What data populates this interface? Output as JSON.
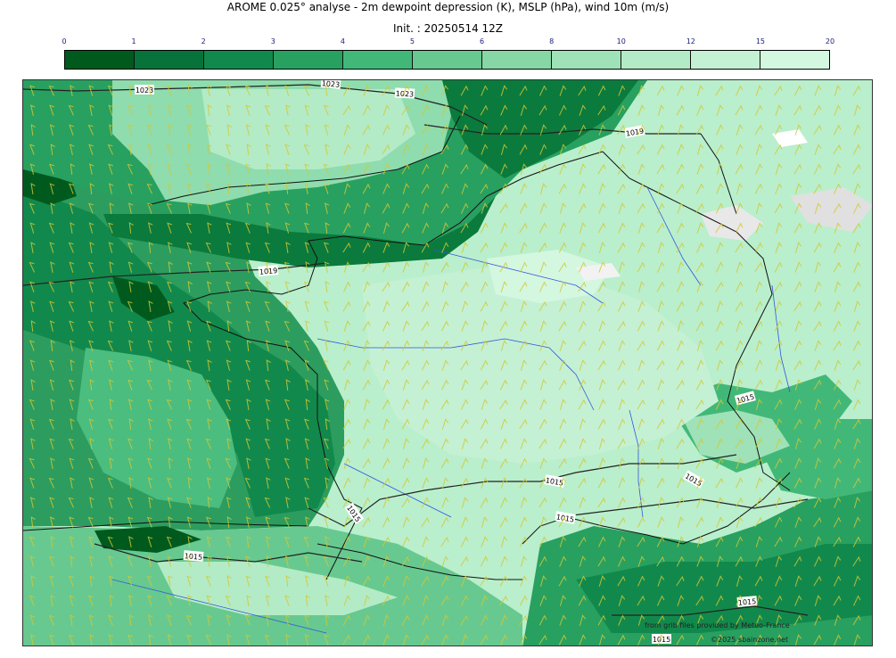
{
  "title": "AROME 0.025° analyse - 2m dewpoint depression (K), MSLP (hPa), wind 10m (m/s)",
  "init": "Init. : 20250514 12Z",
  "colorbar": {
    "ticks": [
      "0",
      "1",
      "2",
      "3",
      "4",
      "5",
      "6",
      "8",
      "10",
      "12",
      "15",
      "20"
    ],
    "colors": [
      "#005a1e",
      "#07733a",
      "#12894c",
      "#28a060",
      "#42b878",
      "#67c98f",
      "#86d7a5",
      "#9fe2b7",
      "#b3ebc6",
      "#c4f1d3",
      "#d4f7df"
    ]
  },
  "isobar_labels": [
    "1023",
    "1023",
    "1023",
    "1019",
    "1019",
    "1015",
    "1015",
    "1015",
    "1015",
    "1015",
    "1015",
    "1015",
    "1015"
  ],
  "credits": {
    "source": "from grib files provided by Meteo-France",
    "copyright": "©2025 sbainzone.net"
  }
}
